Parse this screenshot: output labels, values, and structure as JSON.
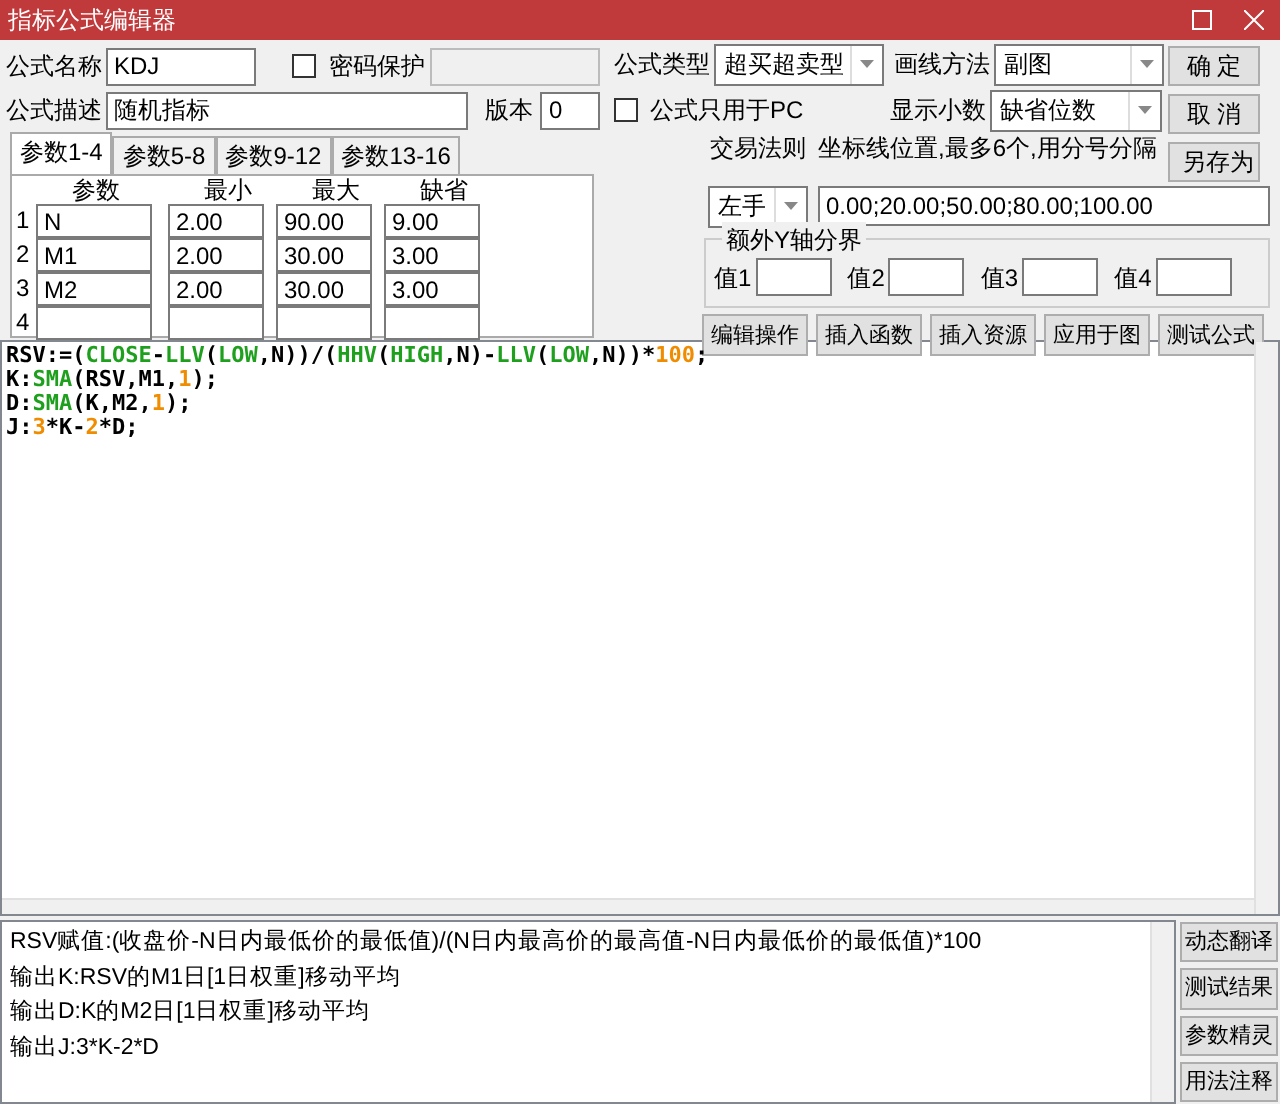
{
  "window": {
    "title": "指标公式编辑器"
  },
  "form": {
    "name_label": "公式名称",
    "name_value": "KDJ",
    "password": {
      "label": "密码保护",
      "checked": false
    },
    "desc_label": "公式描述",
    "desc_value": "随机指标",
    "version_label": "版本",
    "version_value": "0",
    "type_label": "公式类型",
    "type_value": "超买超卖型",
    "draw_label": "画线方法",
    "draw_value": "副图",
    "pc_only": {
      "label": "公式只用于PC",
      "checked": false
    },
    "decimals_label": "显示小数",
    "decimals_value": "缺省位数",
    "trade_label": "交易法则",
    "trade_value": "左手",
    "axis_label": "坐标线位置,最多6个,用分号分隔",
    "axis_value": "0.00;20.00;50.00;80.00;100.00"
  },
  "side_buttons": [
    "确 定",
    "取 消",
    "另存为"
  ],
  "param_tabs": [
    {
      "label": "参数1-4",
      "selected": true
    },
    {
      "label": "参数5-8",
      "selected": false
    },
    {
      "label": "参数9-12",
      "selected": false
    },
    {
      "label": "参数13-16",
      "selected": false
    }
  ],
  "params": {
    "columns": [
      "参数",
      "最小",
      "最大",
      "缺省"
    ],
    "rows": [
      {
        "index": "1",
        "cells": [
          "N",
          "2.00",
          "90.00",
          "9.00"
        ]
      },
      {
        "index": "2",
        "cells": [
          "M1",
          "2.00",
          "30.00",
          "3.00"
        ]
      },
      {
        "index": "3",
        "cells": [
          "M2",
          "2.00",
          "30.00",
          "3.00"
        ]
      },
      {
        "index": "4"
      }
    ]
  },
  "y_bounds": {
    "title": "额外Y轴分界",
    "labels": [
      "值1",
      "值2",
      "值3",
      "值4"
    ]
  },
  "action_buttons": [
    "编辑操作",
    "插入函数",
    "插入资源",
    "应用于图",
    "测试公式"
  ],
  "code": [
    {
      "tokens": [
        {
          "kind": "plain",
          "text": "RSV:=("
        },
        {
          "kind": "func",
          "text": "CLOSE"
        },
        {
          "kind": "plain",
          "text": "-"
        },
        {
          "kind": "func",
          "text": "LLV"
        },
        {
          "kind": "plain",
          "text": "("
        },
        {
          "kind": "func",
          "text": "LOW"
        },
        {
          "kind": "plain",
          "text": ",N))/("
        },
        {
          "kind": "func",
          "text": "HHV"
        },
        {
          "kind": "plain",
          "text": "("
        },
        {
          "kind": "func",
          "text": "HIGH"
        },
        {
          "kind": "plain",
          "text": ",N)-"
        },
        {
          "kind": "func",
          "text": "LLV"
        },
        {
          "kind": "plain",
          "text": "("
        },
        {
          "kind": "func",
          "text": "LOW"
        },
        {
          "kind": "plain",
          "text": ",N))*"
        },
        {
          "kind": "num",
          "text": "100"
        },
        {
          "kind": "plain",
          "text": ";"
        }
      ]
    },
    {
      "tokens": [
        {
          "kind": "plain",
          "text": "K:"
        },
        {
          "kind": "func",
          "text": "SMA"
        },
        {
          "kind": "plain",
          "text": "(RSV,M1,"
        },
        {
          "kind": "num",
          "text": "1"
        },
        {
          "kind": "plain",
          "text": ");"
        }
      ]
    },
    {
      "tokens": [
        {
          "kind": "plain",
          "text": "D:"
        },
        {
          "kind": "func",
          "text": "SMA"
        },
        {
          "kind": "plain",
          "text": "(K,M2,"
        },
        {
          "kind": "num",
          "text": "1"
        },
        {
          "kind": "plain",
          "text": ");"
        }
      ]
    },
    {
      "tokens": [
        {
          "kind": "plain",
          "text": "J:"
        },
        {
          "kind": "num",
          "text": "3"
        },
        {
          "kind": "plain",
          "text": "*K-"
        },
        {
          "kind": "num",
          "text": "2"
        },
        {
          "kind": "plain",
          "text": "*D;"
        }
      ]
    }
  ],
  "explanation": [
    "RSV赋值:(收盘价-N日内最低价的最低值)/(N日内最高价的最高值-N日内最低价的最低值)*100",
    "输出K:RSV的M1日[1日权重]移动平均",
    "输出D:K的M2日[1日权重]移动平均",
    "输出J:3*K-2*D"
  ],
  "bottom_buttons": [
    "动态翻译",
    "测试结果",
    "参数精灵",
    "用法注释"
  ]
}
